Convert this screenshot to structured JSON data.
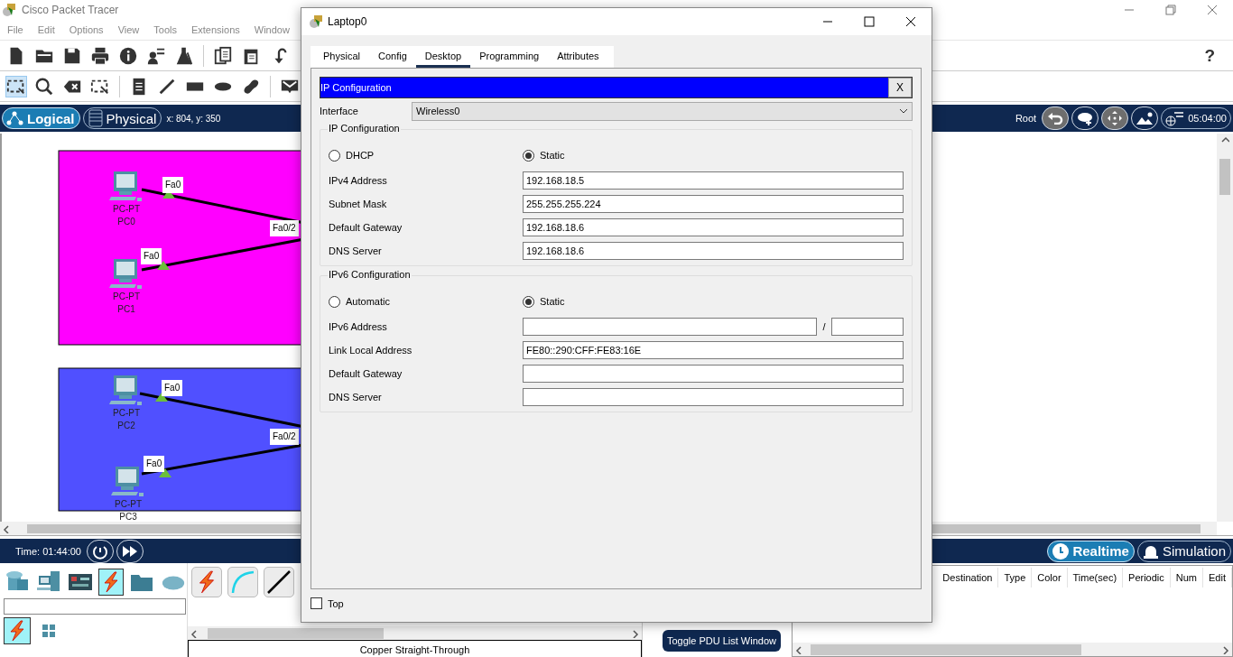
{
  "window": {
    "title": "Cisco Packet Tracer"
  },
  "menu": [
    "File",
    "Edit",
    "Options",
    "View",
    "Tools",
    "Extensions",
    "Window"
  ],
  "help": "?",
  "workspace_bar": {
    "views": [
      {
        "label": "Logical",
        "selected": true
      },
      {
        "label": "Physical",
        "selected": false
      }
    ],
    "coordinates": "x: 804, y: 350",
    "root": "Root",
    "clock": "05:04:00"
  },
  "canvas": {
    "areas": [
      {
        "color": "#ff00ff",
        "switch_port": "Fa0/2",
        "devices": [
          {
            "model": "PC-PT",
            "name": "PC0",
            "port": "Fa0"
          },
          {
            "model": "PC-PT",
            "name": "PC1",
            "port": "Fa0"
          }
        ]
      },
      {
        "color": "#5050ff",
        "switch_port": "Fa0/2",
        "devices": [
          {
            "model": "PC-PT",
            "name": "PC2",
            "port": "Fa0"
          },
          {
            "model": "PC-PT",
            "name": "PC3",
            "port": "Fa0"
          }
        ]
      }
    ]
  },
  "time_bar": {
    "time": "Time: 01:44:00",
    "modes": [
      {
        "label": "Realtime",
        "selected": true
      },
      {
        "label": "Simulation",
        "selected": false
      }
    ]
  },
  "device_panel": {
    "categories": [
      {
        "kind": "network",
        "selected": false
      },
      {
        "kind": "end",
        "selected": false
      },
      {
        "kind": "components",
        "selected": false
      },
      {
        "kind": "connections",
        "selected": true
      },
      {
        "kind": "misc",
        "selected": false
      },
      {
        "kind": "cloud",
        "selected": false
      }
    ],
    "subcategories": [
      {
        "kind": "connections",
        "selected": true
      },
      {
        "kind": "grid",
        "selected": false
      }
    ]
  },
  "connections": {
    "types": [
      {
        "kind": "automatic"
      },
      {
        "kind": "console"
      },
      {
        "kind": "straight"
      }
    ],
    "caption": "Copper Straight-Through"
  },
  "pdu": {
    "toggle_button": "Toggle PDU List Window",
    "columns": [
      "Destination",
      "Type",
      "Color",
      "Time(sec)",
      "Periodic",
      "Num",
      "Edit"
    ]
  },
  "dialog": {
    "title": "Laptop0",
    "tabs": [
      {
        "label": "Physical",
        "selected": false
      },
      {
        "label": "Config",
        "selected": false
      },
      {
        "label": "Desktop",
        "selected": true
      },
      {
        "label": "Programming",
        "selected": false
      },
      {
        "label": "Attributes",
        "selected": false
      }
    ],
    "panel_title": "IP Configuration",
    "close_label": "X",
    "interface": {
      "label": "Interface",
      "value": "Wireless0"
    },
    "ipv4": {
      "title": "IP Configuration",
      "modes": [
        {
          "label": "DHCP",
          "selected": false
        },
        {
          "label": "Static",
          "selected": true
        }
      ],
      "fields": [
        {
          "kind": "plain",
          "label": "IPv4 Address",
          "value": "192.168.18.5"
        },
        {
          "kind": "plain",
          "label": "Subnet Mask",
          "value": "255.255.255.224"
        },
        {
          "kind": "plain",
          "label": "Default Gateway",
          "value": "192.168.18.6"
        },
        {
          "kind": "plain",
          "label": "DNS Server",
          "value": "192.168.18.6"
        }
      ]
    },
    "ipv6": {
      "title": "IPv6 Configuration",
      "modes": [
        {
          "label": "Automatic",
          "selected": false
        },
        {
          "label": "Static",
          "selected": true
        }
      ],
      "fields": [
        {
          "kind": "prefixed",
          "label": "IPv6 Address",
          "separator": "/"
        },
        {
          "kind": "plain",
          "label": "Link Local Address",
          "value": "FE80::290:CFF:FE83:16E"
        },
        {
          "kind": "plain",
          "label": "Default Gateway"
        },
        {
          "kind": "plain",
          "label": "DNS Server"
        }
      ]
    },
    "top": {
      "label": "Top",
      "checked": false
    }
  }
}
